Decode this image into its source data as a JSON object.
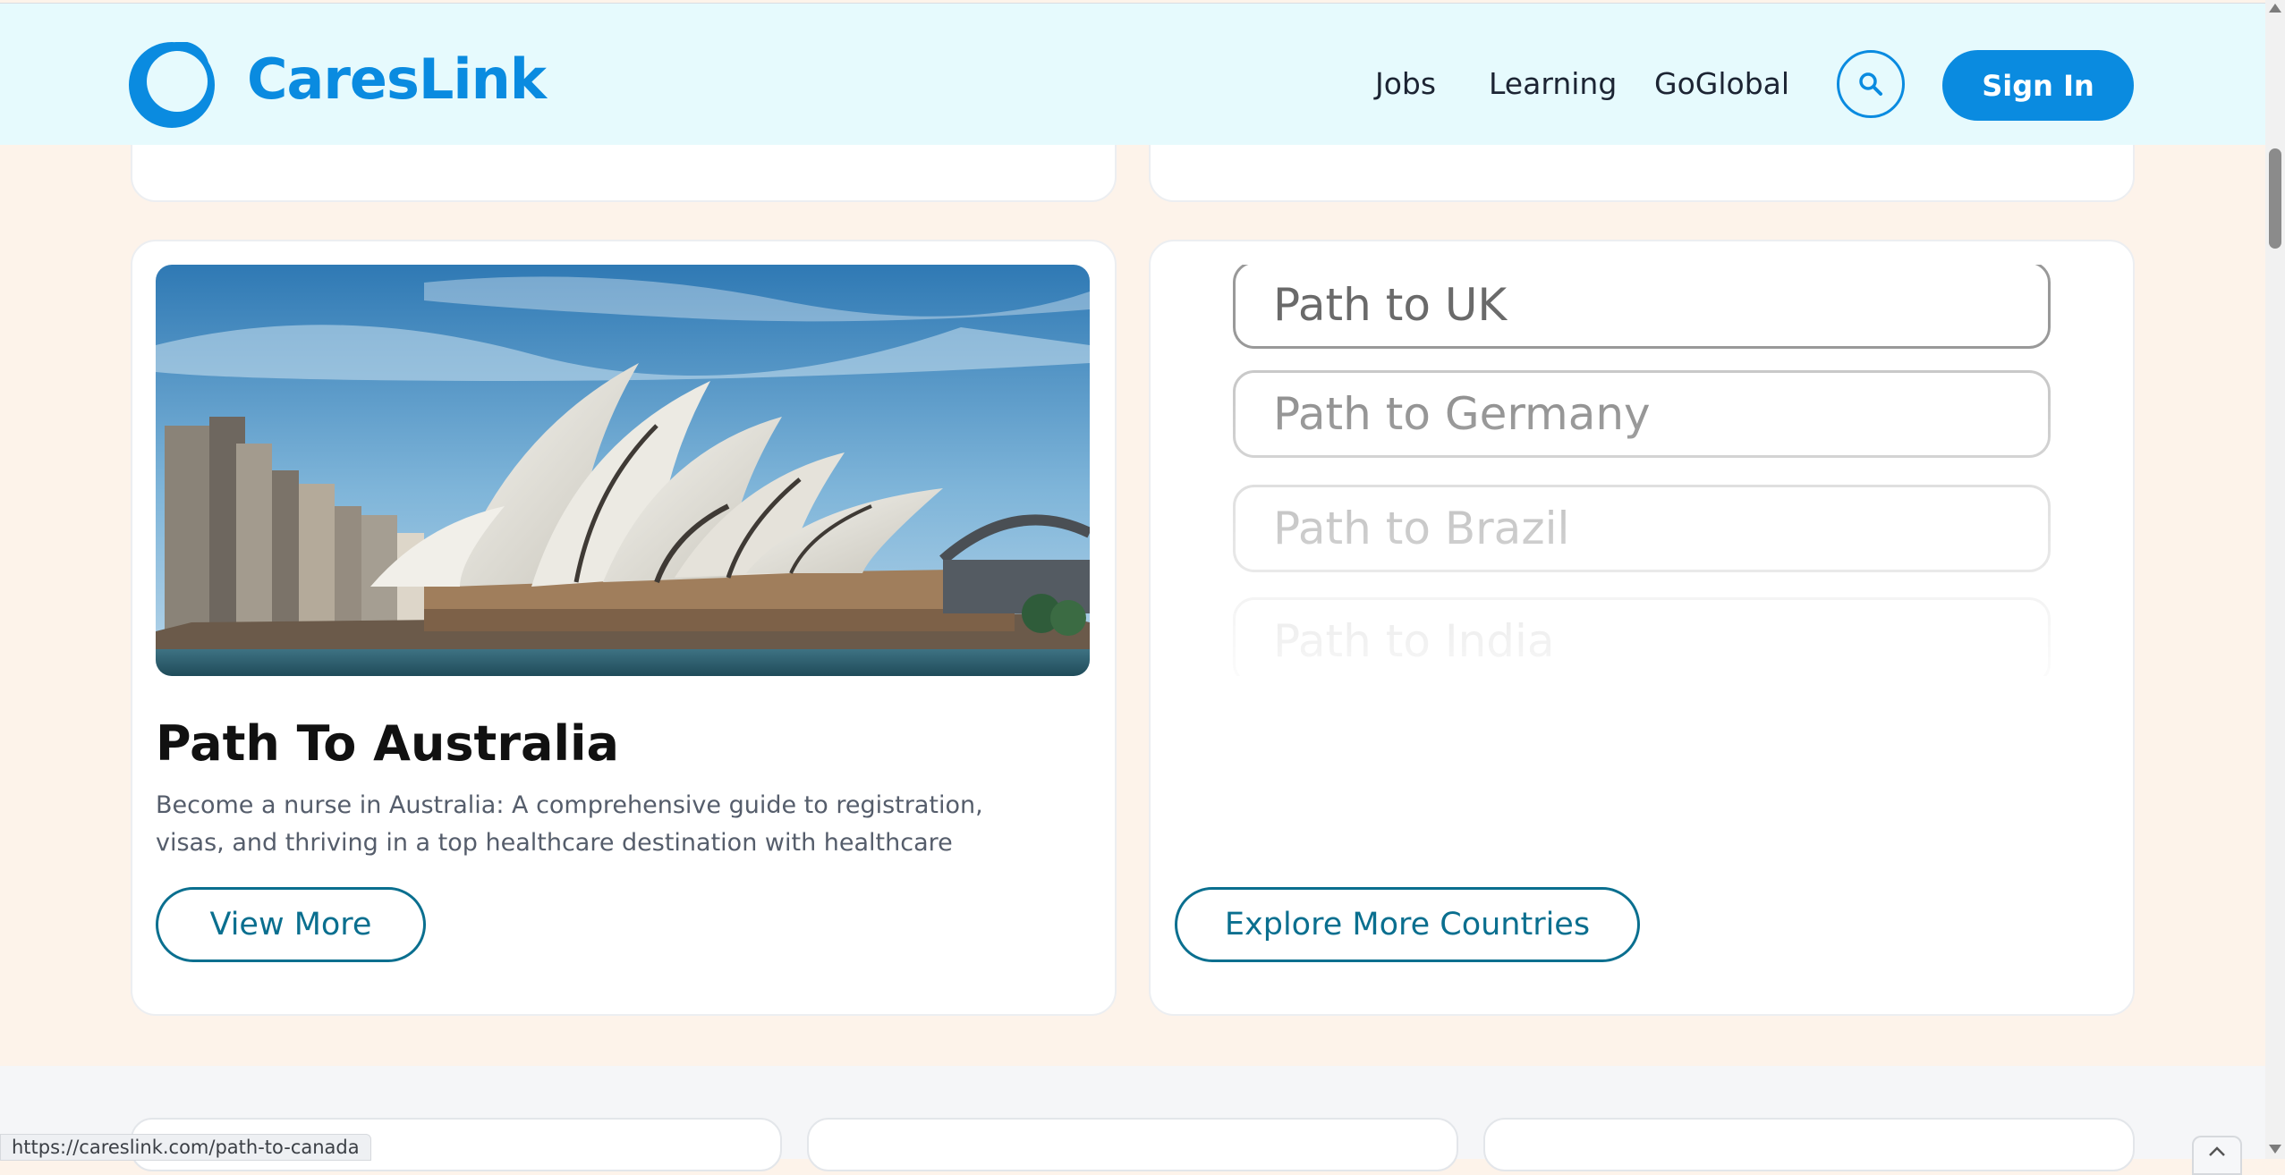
{
  "header": {
    "brand": "CaresLink",
    "nav": [
      {
        "label": "Jobs"
      },
      {
        "label": "Learning"
      },
      {
        "label": "GoGlobal"
      }
    ],
    "sign_in_label": "Sign In"
  },
  "australia_card": {
    "title": "Path To Australia",
    "description": "Become a nurse in Australia: A comprehensive guide to registration, visas, and thriving in a top healthcare destination with healthcare",
    "button_label": "View More"
  },
  "countries_card": {
    "paths": [
      {
        "label": "Path to UK"
      },
      {
        "label": "Path to Germany"
      },
      {
        "label": "Path to Brazil"
      },
      {
        "label": "Path to India"
      }
    ],
    "button_label": "Explore More Countries"
  },
  "status_bar": {
    "url": "https://careslink.com/path-to-canada"
  },
  "colors": {
    "brand_blue": "#0a8be0",
    "teal": "#0a6f8f",
    "page_bg": "#fdf3ea",
    "header_bg": "#e6fafd"
  },
  "icons": [
    "careslink-logo-icon",
    "search-icon",
    "chevron-up-icon"
  ]
}
